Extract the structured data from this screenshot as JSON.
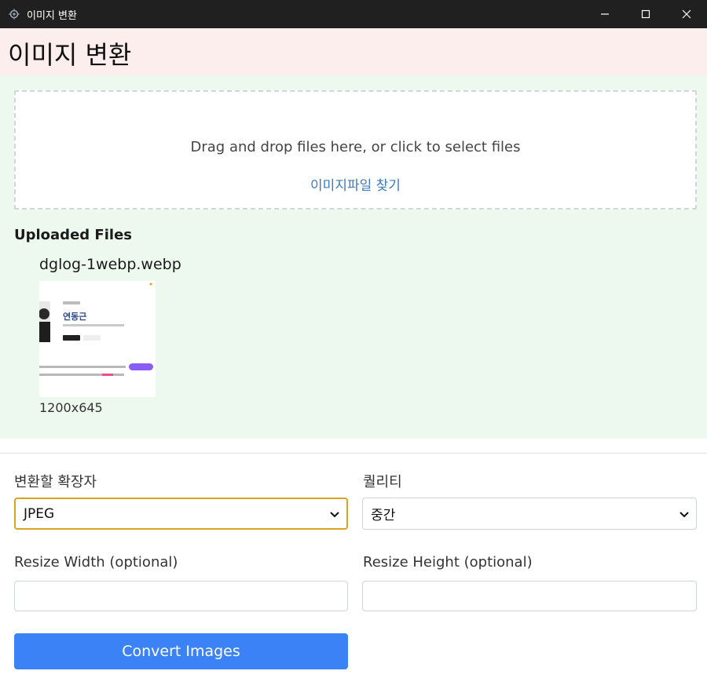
{
  "window": {
    "title": "이미지 변환",
    "app_icon": "gear-app-icon",
    "controls": [
      "minimize-icon",
      "maximize-icon",
      "close-icon"
    ]
  },
  "header": {
    "title": "이미지 변환"
  },
  "dropzone": {
    "instruction": "Drag and drop files here, or click to select files",
    "browse_label": "이미지파일 찾기"
  },
  "uploaded": {
    "heading": "Uploaded Files",
    "files": [
      {
        "name": "dglog-1webp.webp",
        "dimensions": "1200x645",
        "thumbnail": {
          "name_text": "연동근"
        }
      }
    ]
  },
  "form": {
    "format": {
      "label": "변환할 확장자",
      "value": "JPEG"
    },
    "quality": {
      "label": "퀄리티",
      "value": "중간"
    },
    "resize_width": {
      "label": "Resize Width (optional)",
      "value": ""
    },
    "resize_height": {
      "label": "Resize Height (optional)",
      "value": ""
    },
    "convert_label": "Convert Images"
  },
  "colors": {
    "header_bg": "#fdeeee",
    "upload_bg": "#edf9ee",
    "accent": "#3b82f6",
    "link": "#3a7bc0",
    "focus": "#d9a520"
  }
}
